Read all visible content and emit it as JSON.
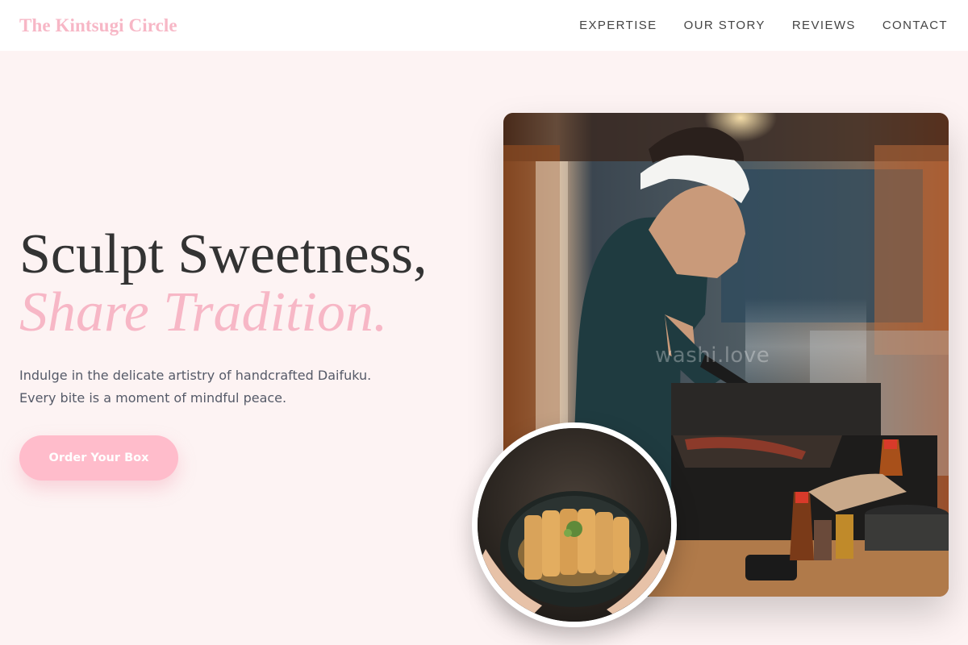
{
  "brand": {
    "name": "The Kintsugi Circle"
  },
  "nav": {
    "links": [
      {
        "label": "EXPERTISE"
      },
      {
        "label": "OUR STORY"
      },
      {
        "label": "REVIEWS"
      },
      {
        "label": "CONTACT"
      }
    ]
  },
  "hero": {
    "title_line1": "Sculpt Sweetness,",
    "title_line2": "Share Tradition.",
    "description": "Indulge in the delicate artistry of handcrafted Daifuku. Every bite is a moment of mindful peace.",
    "cta_label": "Order Your Box"
  },
  "images": {
    "main": {
      "watermark": "washi.love"
    }
  },
  "colors": {
    "accent_pink": "#f7b7c6",
    "button_pink": "#ffbccb",
    "background": "#fdf3f3"
  }
}
